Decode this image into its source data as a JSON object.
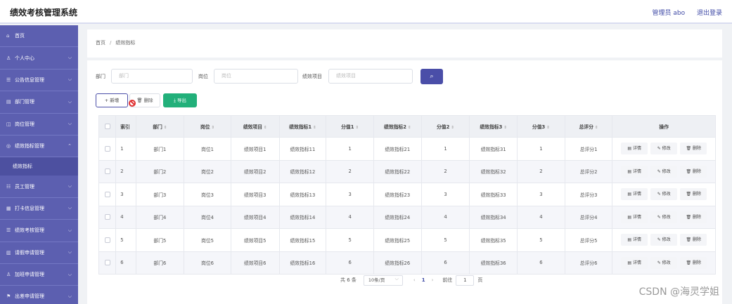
{
  "app": {
    "title": "绩效考核管理系统",
    "user": "管理员 abo",
    "logout": "退出登录"
  },
  "sidebar": {
    "items": [
      {
        "icon": "⌂",
        "label": "首页",
        "chevron": ""
      },
      {
        "icon": "♙",
        "label": "个人中心",
        "chevron": "⌵"
      },
      {
        "icon": "☰",
        "label": "公告信息管理",
        "chevron": "⌵"
      },
      {
        "icon": "▤",
        "label": "部门管理",
        "chevron": "⌵"
      },
      {
        "icon": "◫",
        "label": "岗位管理",
        "chevron": "⌵"
      },
      {
        "icon": "◎",
        "label": "绩效指标管理",
        "chevron": "⌃"
      }
    ],
    "active_sub": "绩效指标",
    "items_after": [
      {
        "icon": "☷",
        "label": "员工管理",
        "chevron": "⌵"
      },
      {
        "icon": "▦",
        "label": "打卡信息管理",
        "chevron": "⌵"
      },
      {
        "icon": "☰",
        "label": "绩效考核管理",
        "chevron": "⌵"
      },
      {
        "icon": "▥",
        "label": "请假申请管理",
        "chevron": "⌵"
      },
      {
        "icon": "♙",
        "label": "加班申请管理",
        "chevron": "⌵"
      },
      {
        "icon": "⚑",
        "label": "出差申请管理",
        "chevron": "⌵"
      }
    ]
  },
  "breadcrumb": {
    "home": "首页",
    "sep": "/",
    "current": "绩效指标"
  },
  "filters": {
    "dept_label": "部门",
    "dept_placeholder": "部门",
    "post_label": "岗位",
    "post_placeholder": "岗位",
    "item_label": "绩效项目",
    "item_placeholder": "绩效项目"
  },
  "toolbar": {
    "add": "+ 新增",
    "delete": "🗑 删除",
    "export": "⤓ 导出"
  },
  "table": {
    "headers": [
      "索引",
      "部门",
      "岗位",
      "绩效项目",
      "绩效指标1",
      "分值1",
      "绩效指标2",
      "分值2",
      "绩效指标3",
      "分值3",
      "总评分",
      "操作"
    ],
    "sort_mark": "⇕",
    "rows": [
      [
        "1",
        "部门1",
        "岗位1",
        "绩效项目1",
        "绩效指标11",
        "1",
        "绩效指标21",
        "1",
        "绩效指标31",
        "1",
        "总评分1"
      ],
      [
        "2",
        "部门2",
        "岗位2",
        "绩效项目2",
        "绩效指标12",
        "2",
        "绩效指标22",
        "2",
        "绩效指标32",
        "2",
        "总评分2"
      ],
      [
        "3",
        "部门3",
        "岗位3",
        "绩效项目3",
        "绩效指标13",
        "3",
        "绩效指标23",
        "3",
        "绩效指标33",
        "3",
        "总评分3"
      ],
      [
        "4",
        "部门4",
        "岗位4",
        "绩效项目4",
        "绩效指标14",
        "4",
        "绩效指标24",
        "4",
        "绩效指标34",
        "4",
        "总评分4"
      ],
      [
        "5",
        "部门5",
        "岗位5",
        "绩效项目5",
        "绩效指标15",
        "5",
        "绩效指标25",
        "5",
        "绩效指标35",
        "5",
        "总评分5"
      ],
      [
        "6",
        "部门6",
        "岗位6",
        "绩效项目6",
        "绩效指标16",
        "6",
        "绩效指标26",
        "6",
        "绩效指标36",
        "6",
        "总评分6"
      ]
    ],
    "actions": {
      "detail": "▤ 详情",
      "edit": "✎ 修改",
      "delete": "🗑 删除"
    }
  },
  "pagination": {
    "total": "共 6 条",
    "page_size": "10条/页",
    "prev": "‹",
    "current": "1",
    "next": "›",
    "goto_label": "前往",
    "goto_value": "1",
    "page_unit": "页"
  },
  "watermark": "CSDN @海灵学姐"
}
